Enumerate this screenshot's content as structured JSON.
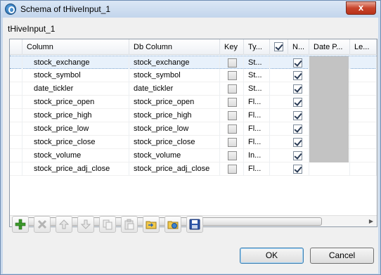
{
  "window": {
    "title": "Schema of tHiveInput_1",
    "close_label": "x"
  },
  "subtitle": "tHiveInput_1",
  "table": {
    "headers": {
      "column": "Column",
      "db_column": "Db Column",
      "key": "Key",
      "type": "Ty...",
      "nullable": "N...",
      "date_pattern": "Date P...",
      "length": "Le..."
    },
    "rows": [
      {
        "column": "stock_exchange",
        "db_column": "stock_exchange",
        "key": false,
        "type": "St...",
        "nullable": true
      },
      {
        "column": "stock_symbol",
        "db_column": "stock_symbol",
        "key": false,
        "type": "St...",
        "nullable": true
      },
      {
        "column": "date_tickler",
        "db_column": "date_tickler",
        "key": false,
        "type": "St...",
        "nullable": true
      },
      {
        "column": "stock_price_open",
        "db_column": "stock_price_open",
        "key": false,
        "type": "Fl...",
        "nullable": true
      },
      {
        "column": "stock_price_high",
        "db_column": "stock_price_high",
        "key": false,
        "type": "Fl...",
        "nullable": true
      },
      {
        "column": "stock_price_low",
        "db_column": "stock_price_low",
        "key": false,
        "type": "Fl...",
        "nullable": true
      },
      {
        "column": "stock_price_close",
        "db_column": "stock_price_close",
        "key": false,
        "type": "Fl...",
        "nullable": true
      },
      {
        "column": "stock_volume",
        "db_column": "stock_volume",
        "key": false,
        "type": "In...",
        "nullable": true
      },
      {
        "column": "stock_price_adj_close",
        "db_column": "stock_price_adj_close",
        "key": false,
        "type": "Fl...",
        "nullable": true
      }
    ]
  },
  "scrollbar": {
    "left_arrow": "◀",
    "right_arrow": "▶",
    "grip": "|||"
  },
  "toolbar": {
    "buttons": [
      {
        "name": "add-row-button",
        "icon": "plus-icon",
        "enabled": true
      },
      {
        "name": "remove-row-button",
        "icon": "x-icon",
        "enabled": false
      },
      {
        "name": "move-up-button",
        "icon": "arrow-up-icon",
        "enabled": false
      },
      {
        "name": "move-down-button",
        "icon": "arrow-down-icon",
        "enabled": false
      },
      {
        "name": "copy-button",
        "icon": "copy-icon",
        "enabled": false
      },
      {
        "name": "paste-button",
        "icon": "paste-icon",
        "enabled": false
      },
      {
        "name": "import-schema-button",
        "icon": "folder-import-icon",
        "enabled": true
      },
      {
        "name": "export-schema-button",
        "icon": "folder-export-icon",
        "enabled": true
      },
      {
        "name": "save-schema-button",
        "icon": "save-disk-icon",
        "enabled": true
      }
    ]
  },
  "buttons": {
    "ok": "OK",
    "cancel": "Cancel"
  }
}
